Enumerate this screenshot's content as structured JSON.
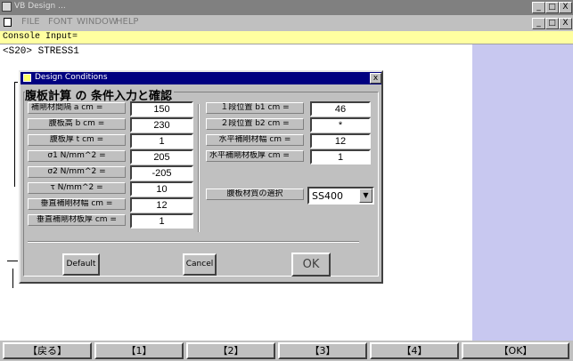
{
  "window": {
    "title": "VB Design  ...",
    "buttons": [
      "_",
      "□",
      "X"
    ]
  },
  "menu": {
    "items": [
      "FILE",
      "FONT",
      "WINDOW",
      "HELP"
    ],
    "doc_buttons": [
      "_",
      "□",
      "X"
    ]
  },
  "console": {
    "label": "Console Input=",
    "value": ""
  },
  "document": {
    "line1": "<S20> STRESS1"
  },
  "dialog": {
    "title": "Design Conditions",
    "close": "x",
    "heading": "腹板計算 の 条件入力と確認",
    "left_fields": [
      {
        "label": "補剛材間隔  a cm =",
        "value": "150"
      },
      {
        "label": "腹板高     b cm =",
        "value": "230"
      },
      {
        "label": "腹板厚     t cm =",
        "value": "1"
      },
      {
        "label": "σ1      N/mm^2 =",
        "value": "205"
      },
      {
        "label": "σ2      N/mm^2 =",
        "value": "-205"
      },
      {
        "label": "τ        N/mm^2 =",
        "value": "10"
      },
      {
        "label": "垂直補剛材幅  cm =",
        "value": "12"
      },
      {
        "label": "垂直補剛材板厚 cm =",
        "value": "1"
      }
    ],
    "right_fields": [
      {
        "label": "１段位置  b1 cm =",
        "value": "46"
      },
      {
        "label": "２段位置  b2 cm =",
        "value": "*"
      },
      {
        "label": "水平補剛材幅  cm =",
        "value": "12"
      },
      {
        "label": "水平補剛材板厚 cm =",
        "value": "1"
      }
    ],
    "material": {
      "label": "腹板材質の選択",
      "value": "SS400"
    },
    "buttons": {
      "default": "Default",
      "cancel": "Cancel",
      "ok": "OK"
    }
  },
  "function_keys": [
    "【戻る】",
    "【1】",
    "【2】",
    "【3】",
    "【4】",
    "【OK】"
  ],
  "colors": {
    "console_bg": "#ffffa0",
    "dialog_title_bg": "#000080",
    "right_panel": "#c8c8f0"
  }
}
